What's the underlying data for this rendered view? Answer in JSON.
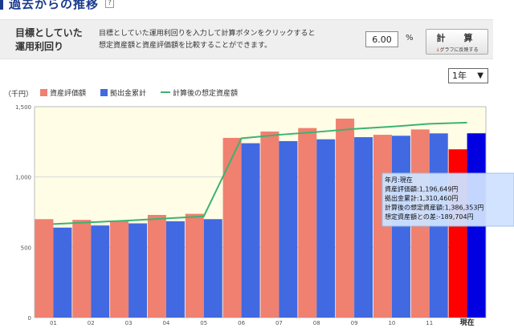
{
  "header": {
    "title": "過去からの推移",
    "help_icon": "?"
  },
  "target_panel": {
    "label_line1": "目標としていた",
    "label_line2": "運用利回り",
    "description_line1": "目標としていた運用利回りを入力して計算ボタンをクリックすると",
    "description_line2": "想定資産額と資産評価額を比較することができます。",
    "rate_value": "6.00",
    "unit": "%",
    "calc_button_label": "計　算",
    "calc_button_sub": "グラフに反映する",
    "calc_button_sub_arrow": "↓"
  },
  "period_select": {
    "selected": "1年"
  },
  "colors": {
    "asset_value": "#f08070",
    "contribution": "#4169e1",
    "expected": "#3cb371",
    "current_asset": "#ff0000",
    "current_contribution": "#0000e0",
    "plot_bg": "#fffde6",
    "tooltip_bg": "#cfe2ff"
  },
  "chart_data": {
    "type": "bar",
    "unit_label": "（千円）",
    "categories": [
      "01",
      "02",
      "03",
      "04",
      "05",
      "06",
      "07",
      "08",
      "09",
      "10",
      "11",
      "現在"
    ],
    "series": [
      {
        "name": "資産評価額",
        "type": "bar",
        "values": [
          700,
          695,
          685,
          730,
          738,
          1278,
          1323,
          1348,
          1415,
          1300,
          1338,
          1196.649
        ]
      },
      {
        "name": "拠出金累計",
        "type": "bar",
        "values": [
          640,
          655,
          670,
          685,
          700,
          1240,
          1255,
          1268,
          1283,
          1293,
          1310,
          1310.46
        ]
      },
      {
        "name": "計算後の想定資産額",
        "type": "line",
        "values": [
          665,
          678,
          690,
          705,
          720,
          1275,
          1300,
          1320,
          1342,
          1358,
          1378,
          1386.353
        ]
      }
    ],
    "ylim": [
      0,
      1500
    ],
    "yticks": [
      "0",
      "500",
      "1,000",
      "1,500"
    ],
    "grid": true,
    "legend": "top-left"
  },
  "tooltip": {
    "line1": "年月:現在",
    "line2": "資産評価額:1,196,649円",
    "line3": "拠出金累計:1,310,460円",
    "line4": "計算後の想定資産額:1,386,353円",
    "line5": "想定資産額との差:-189,704円"
  }
}
